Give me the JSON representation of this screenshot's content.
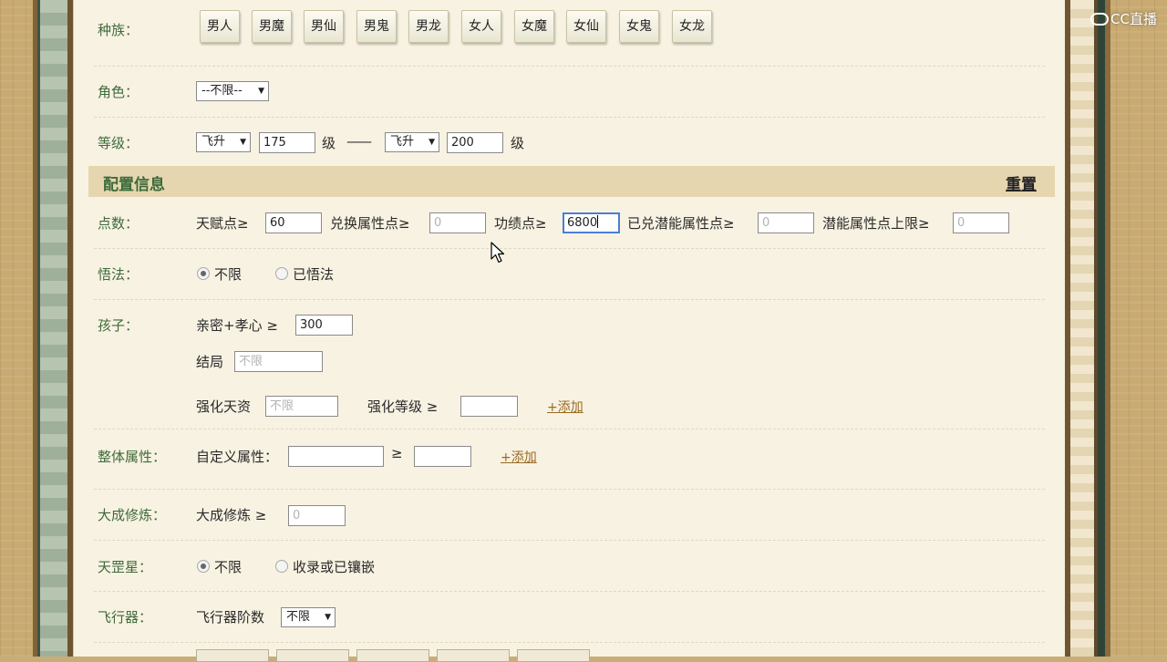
{
  "watermark": "CC直播",
  "race": {
    "label": "种族：",
    "options": [
      "男人",
      "男魔",
      "男仙",
      "男鬼",
      "男龙",
      "女人",
      "女魔",
      "女仙",
      "女鬼",
      "女龙"
    ]
  },
  "role": {
    "label": "角色：",
    "selected": "--不限--"
  },
  "level": {
    "label": "等级：",
    "min_type": "飞升",
    "min_value": "175",
    "unit1": "级",
    "separator": "——",
    "max_type": "飞升",
    "max_value": "200",
    "unit2": "级"
  },
  "config": {
    "title": "配置信息",
    "reset": "重置"
  },
  "points": {
    "label": "点数：",
    "talent_label": "天赋点≥",
    "talent_value": "60",
    "exchange_label": "兑换属性点≥",
    "exchange_placeholder": "0",
    "merit_label": "功绩点≥",
    "merit_value": "6800",
    "potential_label": "已兑潜能属性点≥",
    "potential_placeholder": "0",
    "potential_cap_label": "潜能属性点上限≥",
    "potential_cap_placeholder": "0"
  },
  "enlighten": {
    "label": "悟法：",
    "opt1": "不限",
    "opt2": "已悟法",
    "selected": "不限"
  },
  "child": {
    "label": "孩子：",
    "intimacy_label": "亲密+孝心 ≥",
    "intimacy_value": "300",
    "ending_label": "结局",
    "ending_placeholder": "不限",
    "talent_label": "强化天资",
    "talent_placeholder": "不限",
    "strengthen_label": "强化等级 ≥",
    "strengthen_value": "",
    "add": "+添加"
  },
  "overall": {
    "label": "整体属性：",
    "custom_label": "自定义属性：",
    "custom_value": "",
    "ge": "≥",
    "value": "",
    "add": "+添加"
  },
  "mastery": {
    "label": "大成修炼：",
    "item_label": "大成修炼 ≥",
    "placeholder": "0"
  },
  "tiangang": {
    "label": "天罡星：",
    "opt1": "不限",
    "opt2": "收录或已镶嵌",
    "selected": "不限"
  },
  "aircraft": {
    "label": "飞行器：",
    "item_label": "飞行器阶数",
    "selected": "不限"
  }
}
